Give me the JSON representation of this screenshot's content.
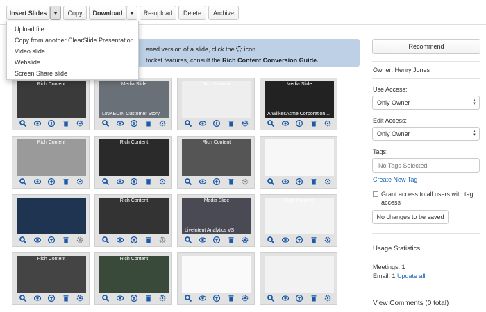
{
  "toolbar": {
    "insert_slides": "Insert Slides",
    "copy": "Copy",
    "download": "Download",
    "reupload": "Re-upload",
    "delete": "Delete",
    "archive": "Archive"
  },
  "insert_menu": {
    "items": [
      "Upload file",
      "Copy from another ClearSlide Presentation",
      "Video slide",
      "Webslide",
      "Screen Share slide"
    ]
  },
  "info_banner": {
    "line1_text": "ened version of a slide, click the",
    "line1_suffix": "icon.",
    "line2_text": "tocket features, consult the",
    "line2_link": "Rich Content Conversion Guide."
  },
  "slides": [
    {
      "caption": "Rich Content",
      "caption2": "",
      "bg": "#3a3a3a",
      "gear_gray": false
    },
    {
      "caption": "Media Slide",
      "caption2": "LINKEDIN Customer Story",
      "bg": "#6a7078",
      "gear_gray": false
    },
    {
      "caption": "Rich Content",
      "caption2": "",
      "bg": "#eeeeee",
      "gear_gray": false
    },
    {
      "caption": "Media Slide",
      "caption2": "A WilkesAcme Corporation ...",
      "bg": "#222222",
      "gear_gray": false
    },
    {
      "caption": "Rich Content",
      "caption2": "",
      "bg": "#9a9a9a",
      "gear_gray": false
    },
    {
      "caption": "Rich Content",
      "caption2": "",
      "bg": "#2a2a2a",
      "gear_gray": false
    },
    {
      "caption": "Rich Content",
      "caption2": "",
      "bg": "#555555",
      "gear_gray": true
    },
    {
      "caption": "",
      "caption2": "",
      "bg": "#f7f7f7",
      "gear_gray": false
    },
    {
      "caption": "",
      "caption2": "",
      "bg": "#1e3450",
      "gear_gray": true
    },
    {
      "caption": "Rich Content",
      "caption2": "",
      "bg": "#333333",
      "gear_gray": true
    },
    {
      "caption": "Media Slide",
      "caption2": "LiveIntent Analytics VS",
      "bg": "#4a4a55",
      "gear_gray": false
    },
    {
      "caption": "Rich Content",
      "caption2": "",
      "bg": "#f3f3f3",
      "gear_gray": false
    },
    {
      "caption": "Rich Content",
      "caption2": "",
      "bg": "#444444",
      "gear_gray": false
    },
    {
      "caption": "Rich Content",
      "caption2": "",
      "bg": "#3a4a3a",
      "gear_gray": false
    },
    {
      "caption": "",
      "caption2": "",
      "bg": "#fafafa",
      "gear_gray": false
    },
    {
      "caption": "",
      "caption2": "",
      "bg": "#f2f2f2",
      "gear_gray": false
    }
  ],
  "sidebar": {
    "recommend": "Recommend",
    "owner": "Owner: Henry Jones",
    "use_access_label": "Use Access:",
    "use_access_value": "Only Owner",
    "edit_access_label": "Edit Access:",
    "edit_access_value": "Only Owner",
    "tags_label": "Tags:",
    "tags_placeholder": "No Tags Selected",
    "create_tag": "Create New Tag",
    "grant_access": "Grant access to all users with tag access",
    "no_changes": "No changes to be saved",
    "usage_title": "Usage Statistics",
    "meetings": "Meetings: 1",
    "email_prefix": "Email: 1",
    "update_all": "Update all",
    "view_comments": "View Comments (0 total)"
  },
  "colors": {
    "icon_blue": "#1a5aa8",
    "banner": "#bdd0e6",
    "link": "#1a67b5"
  }
}
